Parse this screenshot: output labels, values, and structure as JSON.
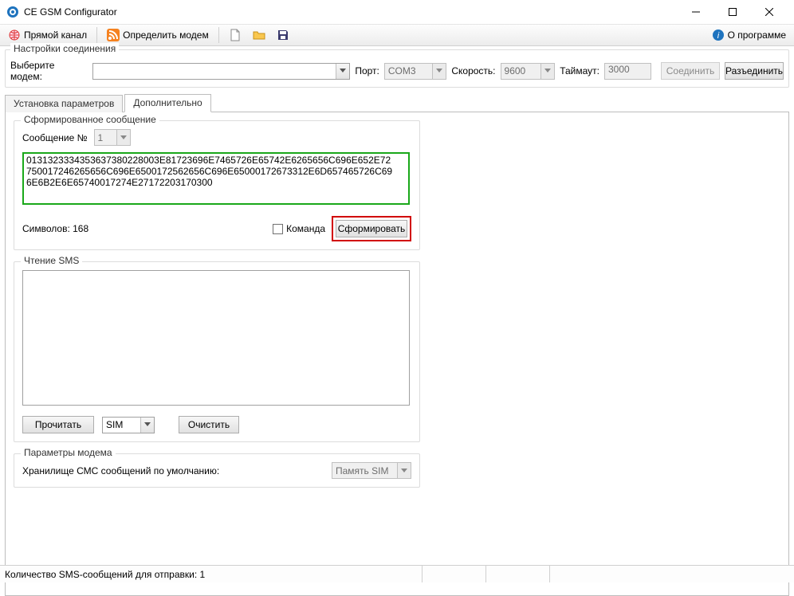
{
  "title": "CE GSM Configurator",
  "toolbar": {
    "direct_channel": "Прямой канал",
    "detect_modem": "Определить модем",
    "about": "О программе"
  },
  "connection": {
    "legend": "Настройки соединения",
    "select_modem_label": "Выберите модем:",
    "modem_value": "",
    "port_label": "Порт:",
    "port_value": "COM3",
    "speed_label": "Скорость:",
    "speed_value": "9600",
    "timeout_label": "Таймаут:",
    "timeout_value": "3000",
    "connect_btn": "Соединить",
    "disconnect_btn": "Разъединить"
  },
  "tabs": {
    "params": "Установка параметров",
    "extra": "Дополнительно"
  },
  "formed_msg": {
    "legend": "Сформированное сообщение",
    "msg_no_label": "Сообщение №",
    "msg_no_value": "1",
    "message_text": "0131323334353637380228003E81723696E7465726E65742E6265656C696E652E72750017246265656C696E6500172562656C696E65000172673312E6D657465726C696E6B2E6E65740017274E27172203170300",
    "chars_label": "Символов: 168",
    "command_label": "Команда",
    "form_btn": "Сформировать"
  },
  "read_sms": {
    "legend": "Чтение SMS",
    "read_btn": "Прочитать",
    "storage_value": "SIM",
    "clear_btn": "Очистить"
  },
  "modem_params": {
    "legend": "Параметры модема",
    "storage_label": "Хранилище СМС сообщений по умолчанию:",
    "storage_value": "Память SIM"
  },
  "status": "Количество SMS-сообщений для отправки: 1"
}
